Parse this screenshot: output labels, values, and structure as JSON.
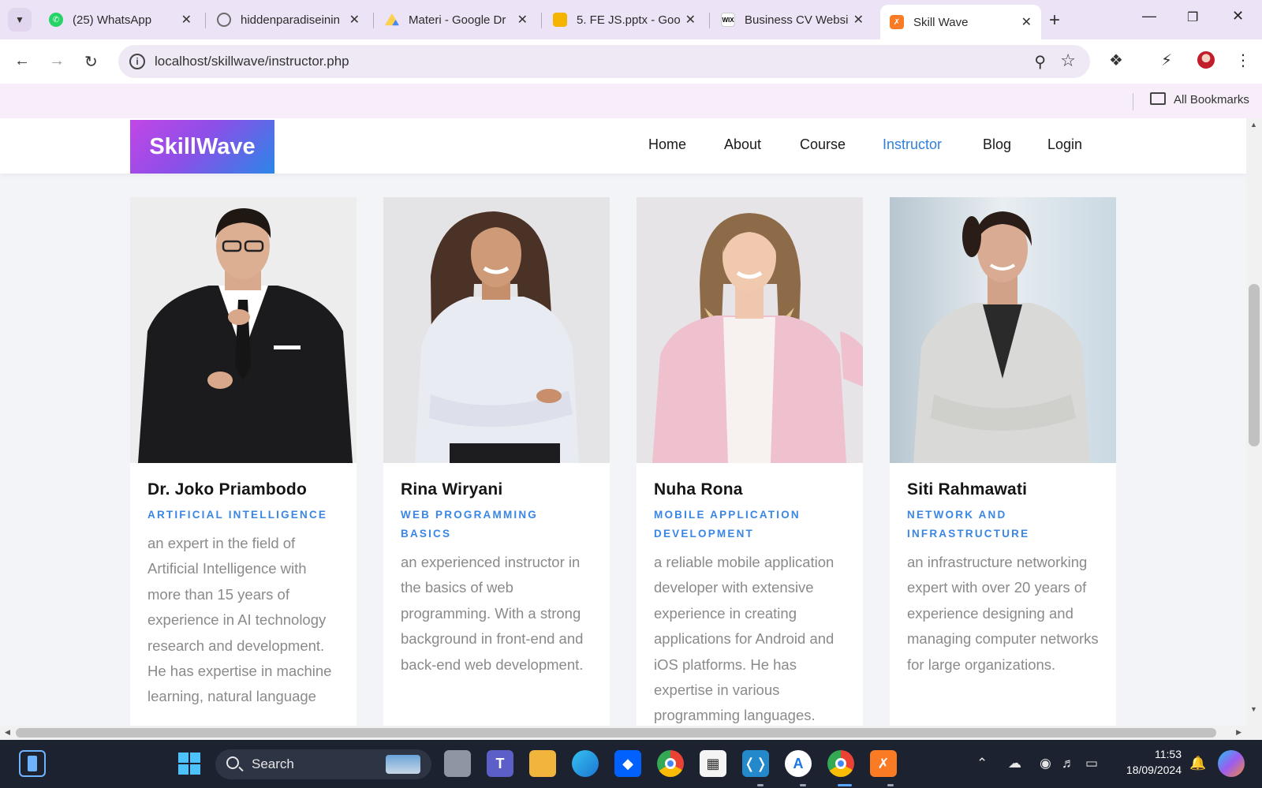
{
  "browser": {
    "tabs": [
      {
        "title": "(25) WhatsApp",
        "favicon": "whatsapp-icon",
        "color": "#25d366"
      },
      {
        "title": "hiddenparadiseinin",
        "favicon": "globe-icon",
        "color": "#7a7a7a"
      },
      {
        "title": "Materi - Google Dr",
        "favicon": "google-drive-icon",
        "color": "#1fa463"
      },
      {
        "title": "5. FE JS.pptx - Goo",
        "favicon": "google-slides-icon",
        "color": "#f4b400"
      },
      {
        "title": "Business CV Websi",
        "favicon": "wix-icon",
        "color": "#000000"
      },
      {
        "title": "Skill Wave",
        "favicon": "xampp-icon",
        "color": "#fb7a24"
      }
    ],
    "active_tab_index": 5,
    "url": "localhost/skillwave/instructor.php",
    "bookmarks_label": "All Bookmarks"
  },
  "site": {
    "logo": "SkillWave",
    "menu": [
      "Home",
      "About",
      "Course",
      "Instructor",
      "Blog",
      "Login"
    ],
    "active_menu": "Instructor",
    "accent_color": "#2f7fe0"
  },
  "instructors": [
    {
      "name": "Dr. Joko Priambodo",
      "role": "ARTIFICIAL INTELLIGENCE",
      "description": "an expert in the field of Artificial Intelligence with more than 15 years of experience in AI technology research and development. He has expertise in machine learning, natural language"
    },
    {
      "name": "Rina Wiryani",
      "role": "WEB PROGRAMMING BASICS",
      "description": "an experienced instructor in the basics of web programming. With a strong background in front-end and back-end web development."
    },
    {
      "name": "Nuha Rona",
      "role": "MOBILE APPLICATION DEVELOPMENT",
      "description": "a reliable mobile application developer with extensive experience in creating applications for Android and iOS platforms. He has expertise in various programming languages."
    },
    {
      "name": "Siti Rahmawati",
      "role": "NETWORK AND INFRASTRUCTURE",
      "description": "an infrastructure networking expert with over 20 years of experience designing and managing computer networks for large organizations."
    }
  ],
  "taskbar": {
    "search_label": "Search",
    "time": "11:53",
    "date": "18/09/2024"
  }
}
